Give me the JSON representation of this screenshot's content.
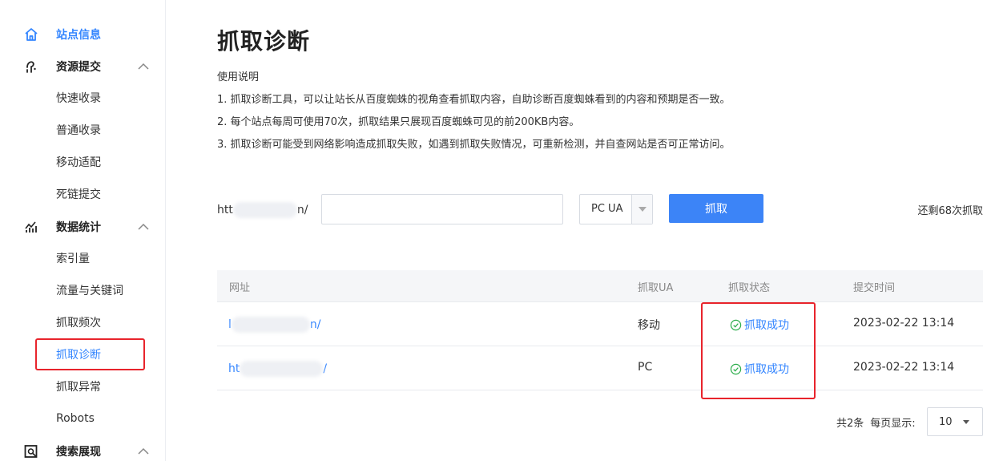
{
  "sidebar": {
    "site_info": "站点信息",
    "resource_submit": {
      "label": "资源提交",
      "items": [
        "快速收录",
        "普通收录",
        "移动适配",
        "死链提交"
      ]
    },
    "data_stats": {
      "label": "数据统计",
      "items": [
        "索引量",
        "流量与关键词",
        "抓取频次",
        "抓取诊断",
        "抓取异常",
        "Robots"
      ]
    },
    "search_display": "搜索展现"
  },
  "main": {
    "title": "抓取诊断",
    "usage": {
      "heading": "使用说明",
      "lines": [
        "1. 抓取诊断工具，可以让站长从百度蜘蛛的视角查看抓取内容，自助诊断百度蜘蛛看到的内容和预期是否一致。",
        "2. 每个站点每周可使用70次，抓取结果只展现百度蜘蛛可见的前200KB内容。",
        "3. 抓取诊断可能受到网络影响造成抓取失败，如遇到抓取失败情况，可重新检测，并自查网站是否可正常访问。"
      ]
    },
    "form": {
      "prefix_start": "htt",
      "prefix_end": "n/",
      "url_value": "",
      "ua_value": "PC UA",
      "fetch_label": "抓取",
      "remaining": "还剩68次抓取"
    },
    "table": {
      "headers": [
        "网址",
        "抓取UA",
        "抓取状态",
        "提交时间"
      ],
      "rows": [
        {
          "url_start": "l",
          "url_end": "n/",
          "ua": "移动",
          "status": "抓取成功",
          "time": "2023-02-22 13:14"
        },
        {
          "url_start": "ht",
          "url_end": "/",
          "ua": "PC",
          "status": "抓取成功",
          "time": "2023-02-22 13:14"
        }
      ]
    },
    "pager": {
      "total": "共2条",
      "per_page_label": "每页显示:",
      "page_size": "10"
    }
  },
  "colors": {
    "accent": "#3385ff",
    "button": "#3c84f7",
    "highlight_box": "#e8242c",
    "success": "#2dae4c"
  }
}
